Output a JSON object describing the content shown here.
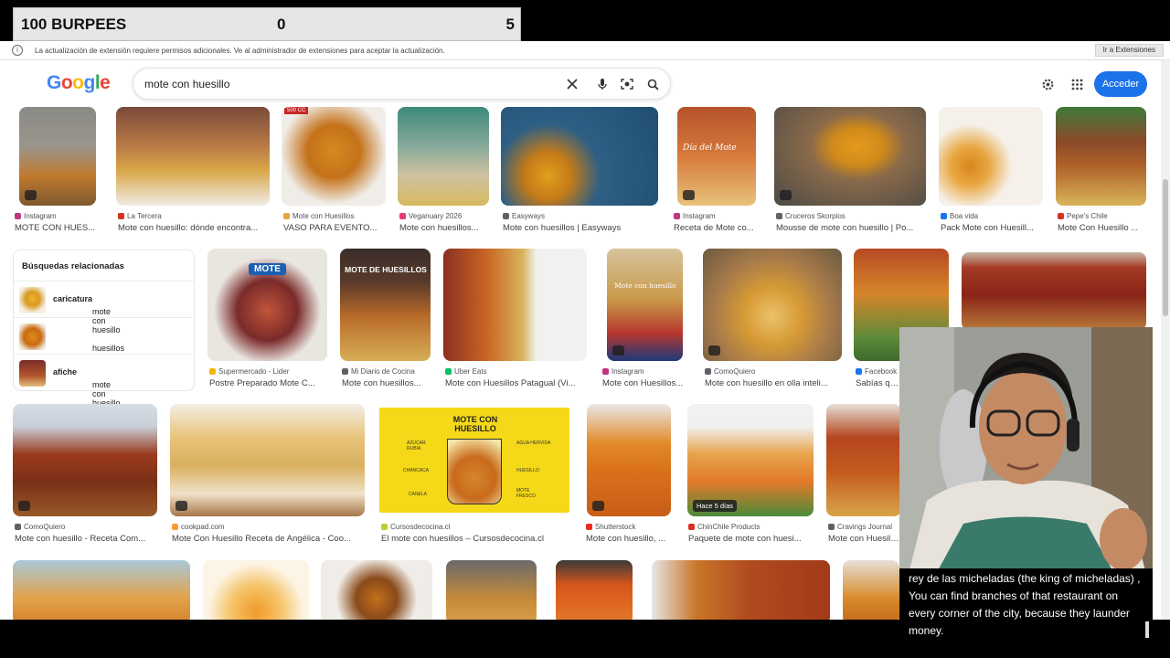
{
  "overlay": {
    "title": "100 BURPEES",
    "count": "0",
    "goal": "5"
  },
  "infobar": {
    "text": "La actualización de extensión requiere permisos adicionales. Ve al administrador de extensiones para aceptar la actualización.",
    "button": "Ir a Extensiones"
  },
  "header": {
    "logo": "Google",
    "search_value": "mote con huesillo",
    "signin": "Acceder"
  },
  "row1": [
    {
      "source": "Instagram",
      "caption": "MOTE CON HUES...",
      "color": "#c13584"
    },
    {
      "source": "La Tercera",
      "caption": "Mote con huesillo: dónde encontra...",
      "color": "#d93025"
    },
    {
      "source": "Mote con Huesillos",
      "caption": "VASO PARA EVENTO...",
      "color": "#e8a33d"
    },
    {
      "source": "Veganuary 2026",
      "caption": "Mote con huesillos...",
      "color": "#e23d6b"
    },
    {
      "source": "Easyways",
      "caption": "Mote con huesillos | Easyways",
      "color": "#5f6368"
    },
    {
      "source": "Instagram",
      "caption": "Receta de Mote co...",
      "color": "#c13584"
    },
    {
      "source": "Cruceros Skorpios",
      "caption": "Mousse de mote con huesillo | Po...",
      "color": "#5f6368"
    },
    {
      "source": "Boa vida",
      "caption": "Pack Mote con Huesill...",
      "color": "#1a73e8"
    },
    {
      "source": "Pepe's Chile",
      "caption": "Mote Con Huesillo ...",
      "color": "#d93025"
    }
  ],
  "related": {
    "title": "Búsquedas relacionadas",
    "items": [
      {
        "pre": "mote con huesillo ",
        "bold": "caricatura",
        "post": ""
      },
      {
        "pre": "huesillos",
        "bold": "",
        "post": ""
      },
      {
        "pre": "",
        "bold": "afiche",
        "post": " mote con huesillo"
      }
    ]
  },
  "row2": [
    {
      "source": "Supermercado - Lider",
      "caption": "Postre Preparado Mote C...",
      "color": "#f2b705"
    },
    {
      "source": "Mi Diario de Cocina",
      "caption": "Mote con huesillos...",
      "color": "#5f6368"
    },
    {
      "source": "Uber Eats",
      "caption": "Mote con Huesillos Patagual (Vi...",
      "color": "#06c167"
    },
    {
      "source": "Instagram",
      "caption": "Mote con Huesillos...",
      "color": "#c13584"
    },
    {
      "source": "ComoQuiero",
      "caption": "Mote con huesillo en olla inteli...",
      "color": "#5f6368"
    },
    {
      "source": "Facebook",
      "caption": "Sabías que...",
      "color": "#1877f2"
    }
  ],
  "row3": [
    {
      "source": "ComoQuiero",
      "caption": "Mote con huesillo - Receta Com...",
      "color": "#5f6368"
    },
    {
      "source": "cookpad.com",
      "caption": "Mote Con Huesillo Receta de Angélica - Coo...",
      "color": "#ff9933"
    },
    {
      "source": "Cursosdecocina.cl",
      "caption": "El mote con huesillos – Cursosdecocina.cl",
      "color": "#c0ca33"
    },
    {
      "source": "Shutterstock",
      "caption": "Mote con huesillo, ...",
      "color": "#ee2b24"
    },
    {
      "source": "ChinChile Products",
      "caption": "Paquete de mote con huesi...",
      "color": "#d93025"
    },
    {
      "source": "Cravings Journal",
      "caption": "Mote con Huesill...",
      "color": "#5f6368"
    }
  ],
  "image_texts": {
    "diagram_title": "MOTE CON HUESILLO",
    "diagram_labels": [
      "AZÚCAR RUBIA",
      "AGUA HERVIDA",
      "CHANCACA",
      "HUESILLO",
      "CANELA",
      "MOTE FRESCO"
    ],
    "package_brand": "MOTE",
    "poster_title": "MOTE DE HUESILLOS",
    "dia_del_mote": "Día del Mote",
    "recent_badge": "Hace 5 días",
    "mote_label": "Mote con huesillo",
    "cup_size": "500 CC"
  },
  "subtitles": {
    "text": "rey de las micheladas (the king of micheladas) , You can find branches of that restaurant on every corner of the city, because they launder money."
  }
}
